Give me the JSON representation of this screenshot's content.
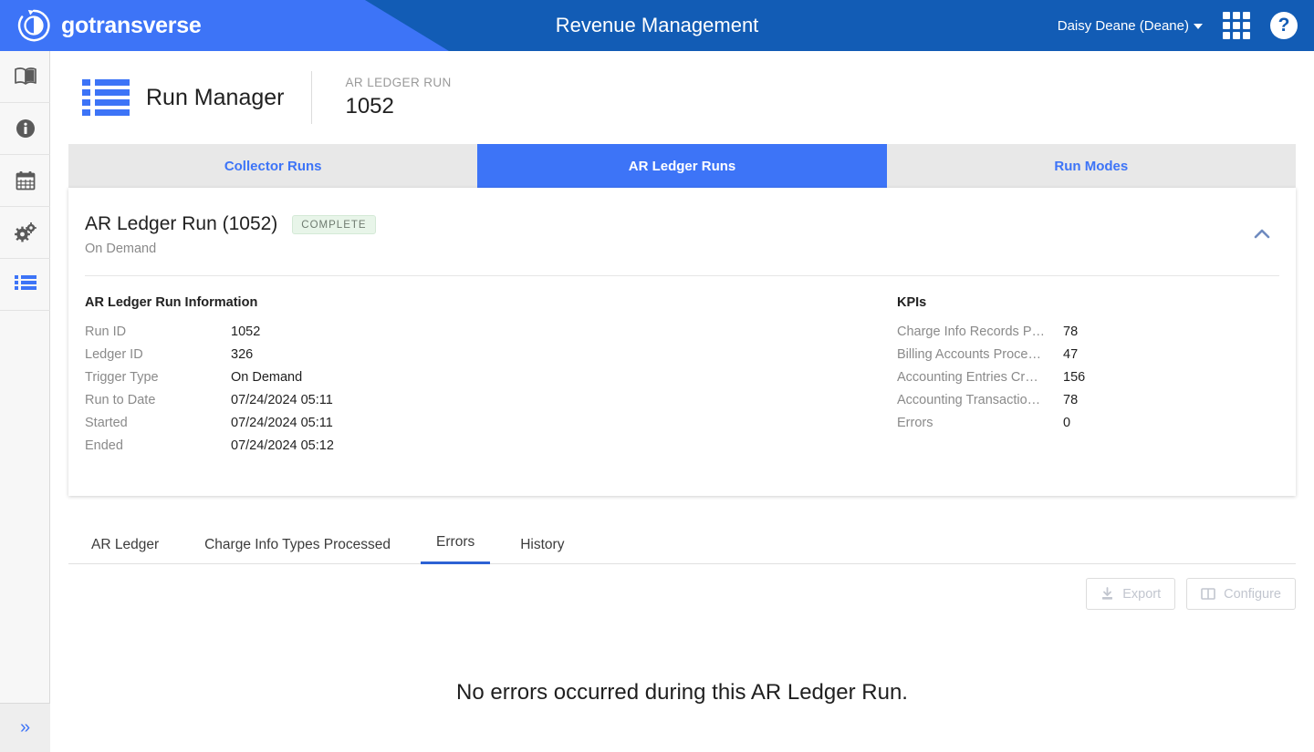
{
  "header": {
    "brand": "gotransverse",
    "brand_logo_icon": "circle-arrow-logo-icon",
    "app_title": "Revenue Management",
    "user": "Daisy Deane (Deane)",
    "apps_icon": "app-grid-icon",
    "help_icon": "help-circle-icon",
    "colors": {
      "left": "#3d74f7",
      "right": "#125cb5"
    }
  },
  "rail": {
    "items": [
      {
        "name": "book-icon",
        "icon": "book-icon",
        "active": false
      },
      {
        "name": "info-icon",
        "icon": "info-circle-icon",
        "active": false
      },
      {
        "name": "calendar-icon",
        "icon": "calendar-icon",
        "active": false
      },
      {
        "name": "gears-icon",
        "icon": "gears-icon",
        "active": false
      },
      {
        "name": "run-manager-icon",
        "icon": "list-icon",
        "active": true
      }
    ],
    "expand_icon": "double-chevron-right-icon"
  },
  "page_header": {
    "icon": "list-icon",
    "title": "Run Manager",
    "context_label": "AR LEDGER RUN",
    "context_value": "1052"
  },
  "segmented_tabs": [
    {
      "label": "Collector Runs",
      "active": false
    },
    {
      "label": "AR Ledger Runs",
      "active": true
    },
    {
      "label": "Run Modes",
      "active": false
    }
  ],
  "card": {
    "title": "AR Ledger Run (1052)",
    "badge": "COMPLETE",
    "badge_color": "#e8f5e9",
    "subtitle": "On Demand",
    "collapse_icon": "chevron-up-icon",
    "info": {
      "section_title": "AR Ledger Run Information",
      "rows": [
        {
          "label": "Run ID",
          "value": "1052"
        },
        {
          "label": "Ledger ID",
          "value": "326"
        },
        {
          "label": "Trigger Type",
          "value": "On Demand"
        },
        {
          "label": "Run to Date",
          "value": "07/24/2024 05:11"
        },
        {
          "label": "Started",
          "value": "07/24/2024 05:11"
        },
        {
          "label": "Ended",
          "value": "07/24/2024 05:12"
        }
      ]
    },
    "kpis": {
      "section_title": "KPIs",
      "rows": [
        {
          "label": "Charge Info Records P…",
          "value": "78"
        },
        {
          "label": "Billing Accounts Proce…",
          "value": "47"
        },
        {
          "label": "Accounting Entries Cr…",
          "value": "156"
        },
        {
          "label": "Accounting Transactio…",
          "value": "78"
        },
        {
          "label": "Errors",
          "value": "0"
        }
      ]
    }
  },
  "sub_tabs": [
    {
      "label": "AR Ledger",
      "active": false
    },
    {
      "label": "Charge Info Types Processed",
      "active": false
    },
    {
      "label": "Errors",
      "active": true
    },
    {
      "label": "History",
      "active": false
    }
  ],
  "toolbar": {
    "export_label": "Export",
    "export_icon": "download-icon",
    "configure_label": "Configure",
    "configure_icon": "columns-icon"
  },
  "empty_state": {
    "message": "No errors occurred during this AR Ledger Run."
  }
}
